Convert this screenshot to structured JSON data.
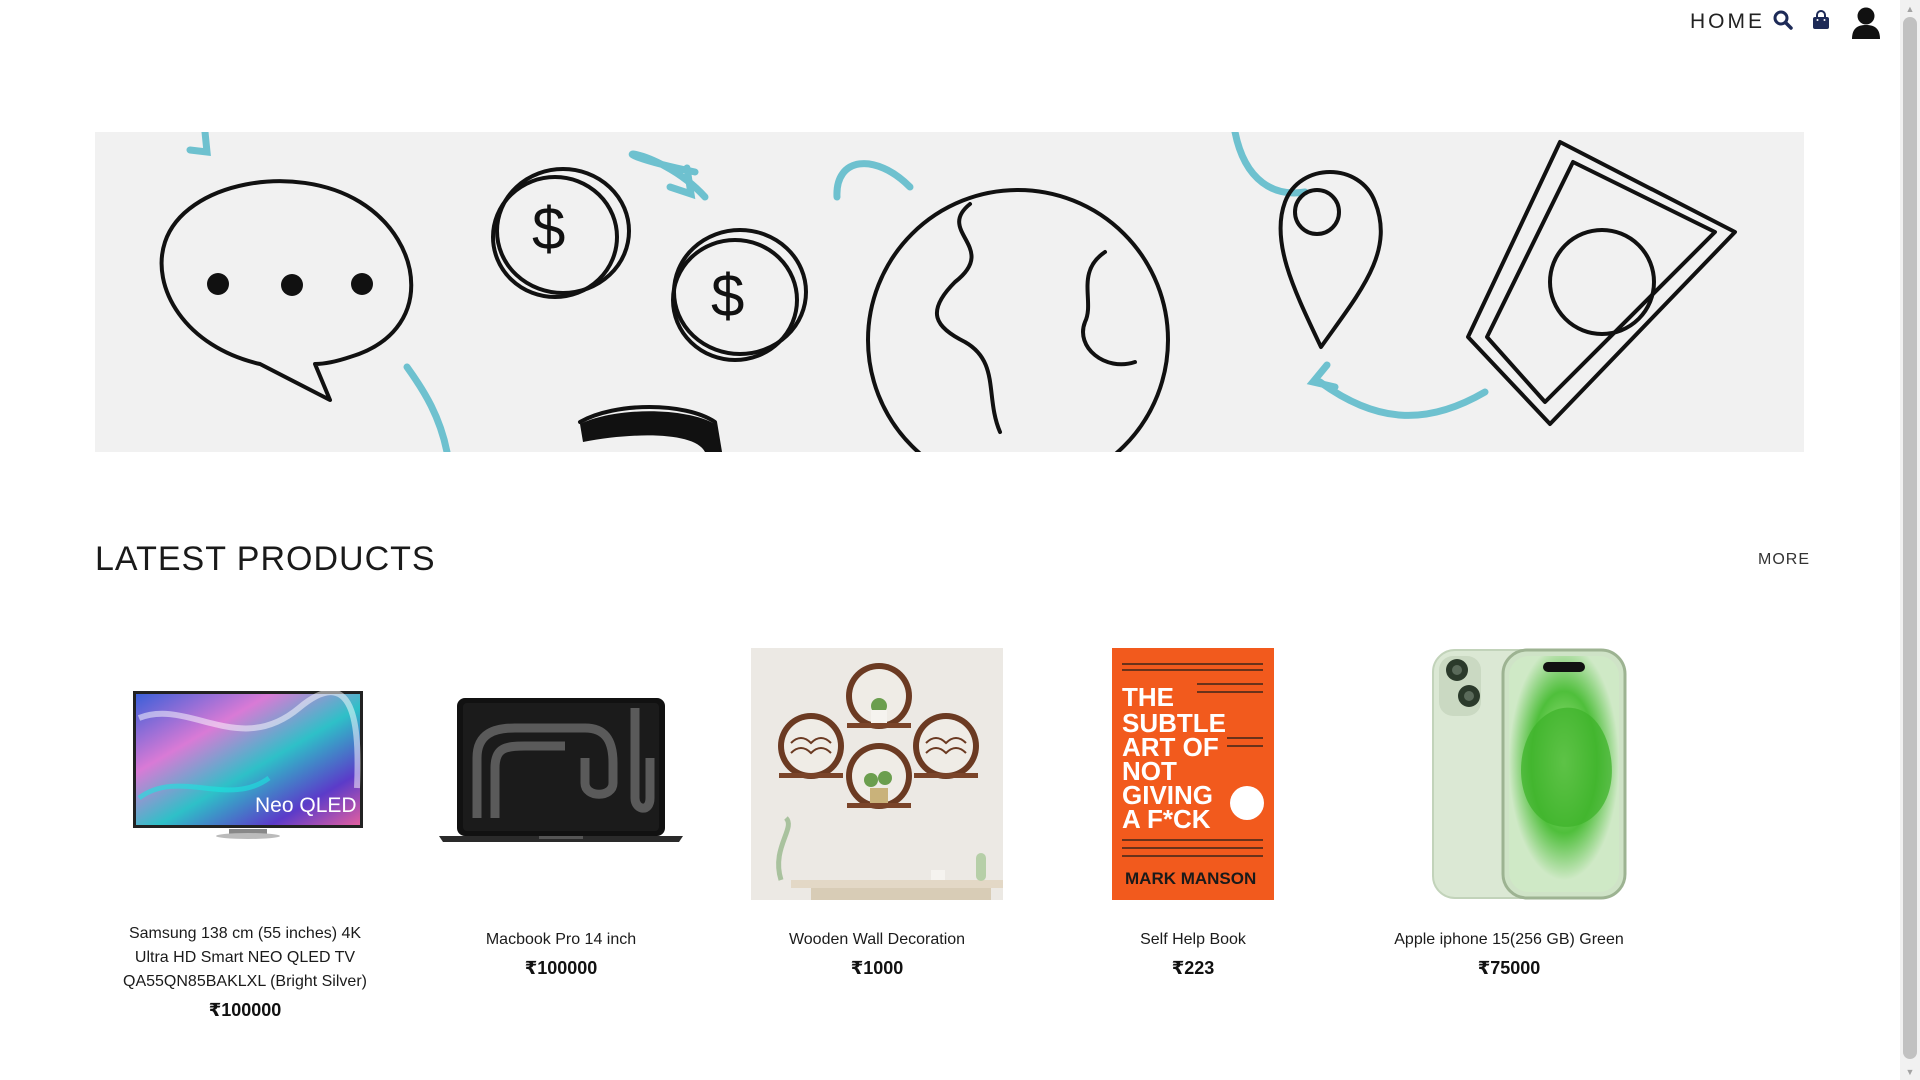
{
  "nav": {
    "home_label": "HOME",
    "icons": [
      "search-icon",
      "shopping-bag-icon",
      "user-icon"
    ]
  },
  "banner": {
    "illustration": "doodle-banner",
    "accent_color": "#6ec1cf"
  },
  "latest": {
    "title": "LATEST PRODUCTS",
    "more_label": "MORE"
  },
  "products": [
    {
      "name": "Samsung 138 cm (55 inches) 4K Ultra HD Smart NEO QLED TV QA55QN85BAKLXL (Bright Silver)",
      "price": "₹100000",
      "image": "tv-image",
      "image_text": "Neo QLED"
    },
    {
      "name": "Macbook Pro 14 inch",
      "price": "₹100000",
      "image": "laptop-image"
    },
    {
      "name": "Wooden Wall Decoration",
      "price": "₹1000",
      "image": "wall-shelf-image"
    },
    {
      "name": "Self Help Book",
      "price": "₹223",
      "image": "book-cover-image",
      "image_text": [
        "THE",
        "SUBTLE",
        "ART OF",
        "NOT",
        "GIVING",
        "A F*CK",
        "MARK MANSON"
      ]
    },
    {
      "name": "Apple iphone 15(256 GB) Green",
      "price": "₹75000",
      "image": "phone-image"
    }
  ]
}
